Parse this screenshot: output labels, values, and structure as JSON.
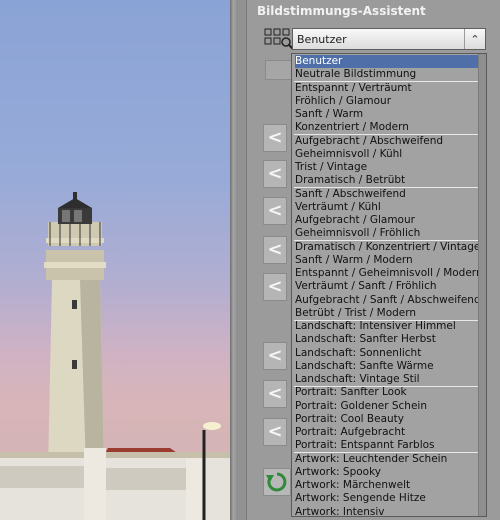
{
  "panel": {
    "title": "Bildstimmungs-Assistent",
    "selected_value": "Benutzer",
    "open_arrow": "⌃",
    "nav_arrow": "<"
  },
  "dropdown": {
    "groups": [
      [
        "Benutzer",
        "Neutrale Bildstimmung"
      ],
      [
        "Entspannt / Verträumt",
        "Fröhlich / Glamour",
        "Sanft / Warm",
        "Konzentriert / Modern"
      ],
      [
        "Aufgebracht / Abschweifend",
        "Geheimnisvoll / Kühl",
        "Trist / Vintage",
        "Dramatisch / Betrübt"
      ],
      [
        "Sanft / Abschweifend",
        "Verträumt / Kühl",
        "Aufgebracht / Glamour",
        "Geheimnisvoll / Fröhlich"
      ],
      [
        "Dramatisch / Konzentriert / Vintage",
        "Sanft / Warm / Modern",
        "Entspannt / Geheimnisvoll / Modern",
        "Verträumt / Sanft / Fröhlich",
        "Aufgebracht / Sanft / Abschweifend",
        "Betrübt / Trist / Modern"
      ],
      [
        "Landschaft: Intensiver Himmel",
        "Landschaft: Sanfter Herbst",
        "Landschaft: Sonnenlicht",
        "Landschaft: Sanfte Wärme",
        "Landschaft: Vintage Stil"
      ],
      [
        "Portrait: Sanfter Look",
        "Portrait: Goldener Schein",
        "Portrait: Cool Beauty",
        "Portrait: Aufgebracht",
        "Portrait: Entspannt Farblos"
      ],
      [
        "Artwork: Leuchtender Schein",
        "Artwork: Spooky",
        "Artwork: Märchenwelt",
        "Artwork: Sengende Hitze",
        "Artwork: Intensiv"
      ]
    ]
  },
  "colors": {
    "selection": "#4e6fa8",
    "panel_bg": "#9b9b9b",
    "title": "#f2f2f2"
  },
  "icons": {
    "mode": "grid-view-icon",
    "reset": "reset-icon",
    "nav": "chevron-left-icon"
  }
}
